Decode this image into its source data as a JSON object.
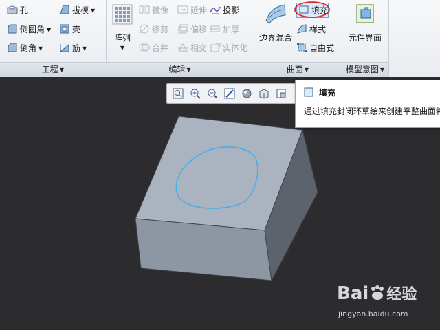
{
  "ribbon": {
    "engineering": {
      "hole": "孔",
      "draft": "拔模",
      "round": "倒圆角",
      "shell": "壳",
      "chamfer": "倒角",
      "rib": "筋",
      "group_label": "工程"
    },
    "editing": {
      "pattern": "阵列",
      "mirror": "镜像",
      "extend": "延伸",
      "project": "投影",
      "trim": "修剪",
      "offset": "偏移",
      "thicken": "加厚",
      "merge": "合并",
      "intersect": "相交",
      "solidify": "实体化",
      "group_label": "编辑"
    },
    "surfaces": {
      "boundary_blend": "边界混合",
      "fill": "填充",
      "style": "样式",
      "freestyle": "自由式",
      "group_label": "曲面"
    },
    "model_intent": {
      "component_interface": "元件界面",
      "group_label": "模型意图"
    }
  },
  "tooltip": {
    "title": "填充",
    "description": "通过填充封闭环草绘来创建平整曲面特"
  },
  "watermark": {
    "brand": "Bai",
    "brand_cn": "经验",
    "url": "jingyan.baidu.com"
  },
  "colors": {
    "fill_highlight_ring": "#d42a2a",
    "sketch_curve": "#3fb0e8",
    "cube_top": "#aab3bf",
    "cube_front": "#8d97a3",
    "cube_right": "#5c636c"
  }
}
